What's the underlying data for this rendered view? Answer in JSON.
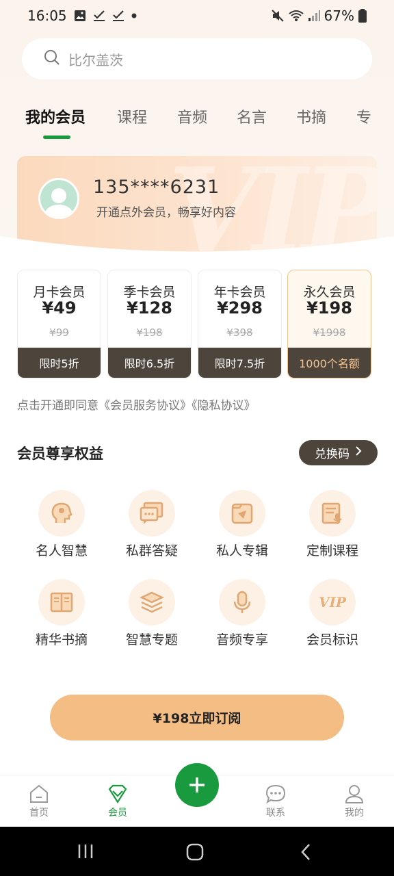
{
  "status_bar": {
    "time": "16:05",
    "battery": "67%"
  },
  "search": {
    "placeholder": "比尔盖茨"
  },
  "tabs": [
    "我的会员",
    "课程",
    "音频",
    "名言",
    "书摘",
    "专"
  ],
  "profile": {
    "phone": "135****6231",
    "subtitle": "开通点外会员，畅享好内容"
  },
  "plans": [
    {
      "name": "月卡会员",
      "price": "¥49",
      "original": "¥99",
      "tag": "限时5折"
    },
    {
      "name": "季卡会员",
      "price": "¥128",
      "original": "¥198",
      "tag": "限时6.5折"
    },
    {
      "name": "年卡会员",
      "price": "¥298",
      "original": "¥398",
      "tag": "限时7.5折"
    },
    {
      "name": "永久会员",
      "price": "¥198",
      "original": "¥1998",
      "tag": "1000个名额"
    }
  ],
  "agreement": "点击开通即同意《会员服务协议》《隐私协议》",
  "benefits": {
    "title": "会员尊享权益",
    "redeem_label": "兑换码",
    "items": [
      {
        "label": "名人智慧",
        "icon": "head-brain-icon"
      },
      {
        "label": "私群答疑",
        "icon": "chat-bubble-icon"
      },
      {
        "label": "私人专辑",
        "icon": "album-icon"
      },
      {
        "label": "定制课程",
        "icon": "course-document-icon"
      },
      {
        "label": "精华书摘",
        "icon": "open-book-icon"
      },
      {
        "label": "智慧专题",
        "icon": "layers-icon"
      },
      {
        "label": "音频专享",
        "icon": "microphone-icon"
      },
      {
        "label": "会员标识",
        "icon": "vip-badge-icon"
      }
    ]
  },
  "subscribe_label": "¥198立即订阅",
  "bottom_nav": [
    {
      "label": "首页",
      "icon": "home-icon"
    },
    {
      "label": "会员",
      "icon": "vip-heart-icon"
    },
    {
      "label": "联系",
      "icon": "chat-icon"
    },
    {
      "label": "我的",
      "icon": "user-icon"
    }
  ],
  "colors": {
    "accent_green": "#1a9a3e",
    "gold": "#f4bd84",
    "dark_brown": "#4d443c"
  }
}
